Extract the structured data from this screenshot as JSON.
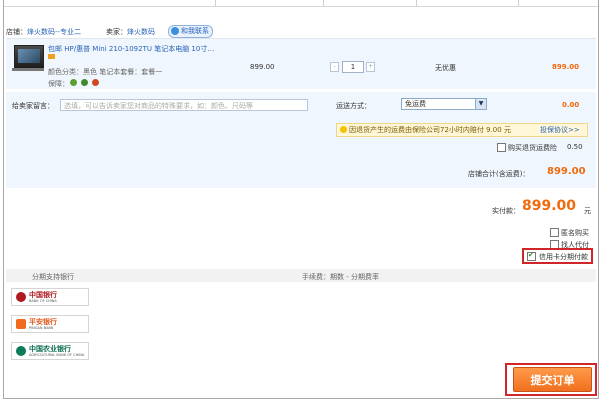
{
  "shop": {
    "shop_label": "店铺：",
    "shop_name": "烽火数码--专业二",
    "seller_label": "卖家：",
    "seller_name": "烽火数码",
    "contact_label": "和我联系"
  },
  "item": {
    "title": "包邮 HP/惠普 Mini 210-1092TU 笔记本电脑 10寸…",
    "spec": "颜色分类：黑色   笔记本套餐：套餐一",
    "guarantee_label": "保障：",
    "unit_price": "899.00",
    "quantity": "1",
    "qty_minus": "-",
    "qty_plus": "+",
    "discount": "无优惠",
    "subtotal": "899.00"
  },
  "message": {
    "label": "给卖家留言：",
    "placeholder": "选填，可以告诉卖家您对商品的特殊要求，如：颜色、尺码等"
  },
  "shipping": {
    "label": "运送方式：",
    "selected": "免运费",
    "fee": "0.00",
    "notice_text": "因退货产生的运费由保险公司72小时内赔付 9.00 元",
    "notice_link": "投保协议>>",
    "insurance_label": "购买退货运费险",
    "insurance_fee": "0.50"
  },
  "shop_total": {
    "label": "店铺合计(含运费)：",
    "value": "899.00"
  },
  "payment": {
    "label": "实付款：",
    "value": "899.00",
    "unit": "元"
  },
  "options": {
    "anonymous": "匿名购买",
    "proxy_pay": "找人代付",
    "installment": "信用卡分期付款"
  },
  "installment_table": {
    "col_bank": "分期支持银行",
    "col_fee": "手续费：期数 - 分期费率"
  },
  "banks": [
    {
      "name": "中国银行",
      "sub": "BANK OF CHINA"
    },
    {
      "name": "平安银行",
      "sub": "PINGAN BANK"
    },
    {
      "name": "中国农业银行",
      "sub": "AGRICULTURAL BANK OF CHINA"
    }
  ],
  "submit_label": "提交订单",
  "colors": {
    "accent": "#f06a0e",
    "link": "#2a63b8",
    "highlight": "#d0262a"
  }
}
